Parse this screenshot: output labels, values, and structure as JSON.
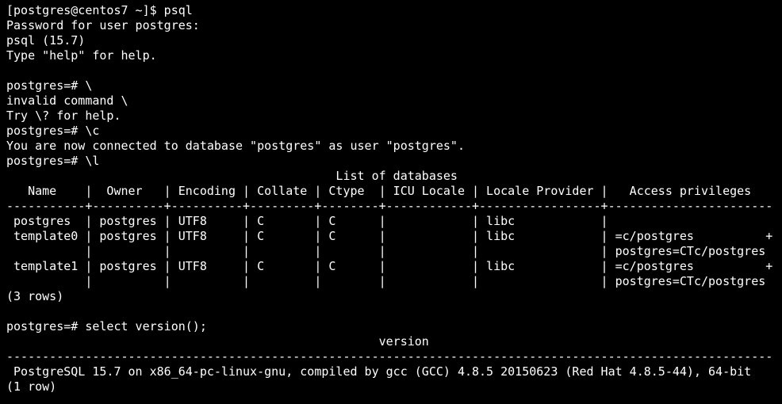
{
  "terminal": {
    "lines": [
      "[postgres@centos7 ~]$ psql",
      "Password for user postgres:",
      "psql (15.7)",
      "Type \"help\" for help.",
      "",
      "postgres=# \\",
      "invalid command \\",
      "Try \\? for help.",
      "postgres=# \\c",
      "You are now connected to database \"postgres\" as user \"postgres\".",
      "postgres=# \\l",
      "                                              List of databases",
      "   Name    |  Owner   | Encoding | Collate | Ctype  | ICU Locale | Locale Provider |   Access privileges",
      "-----------+----------+----------+---------+--------+------------+-----------------+-----------------------",
      " postgres  | postgres | UTF8     | C       | C      |            | libc            |",
      " template0 | postgres | UTF8     | C       | C      |            | libc            | =c/postgres          +",
      "           |          |          |         |        |            |                 | postgres=CTc/postgres",
      " template1 | postgres | UTF8     | C       | C      |            | libc            | =c/postgres          +",
      "           |          |          |         |        |            |                 | postgres=CTc/postgres",
      "(3 rows)",
      "",
      "postgres=# select version();",
      "                                                    version",
      "-----------------------------------------------------------------------------------------------------------",
      " PostgreSQL 15.7 on x86_64-pc-linux-gnu, compiled by gcc (GCC) 4.8.5 20150623 (Red Hat 4.8.5-44), 64-bit",
      "(1 row)"
    ]
  },
  "colors": {
    "background": "#000000",
    "foreground": "#ffffff"
  }
}
